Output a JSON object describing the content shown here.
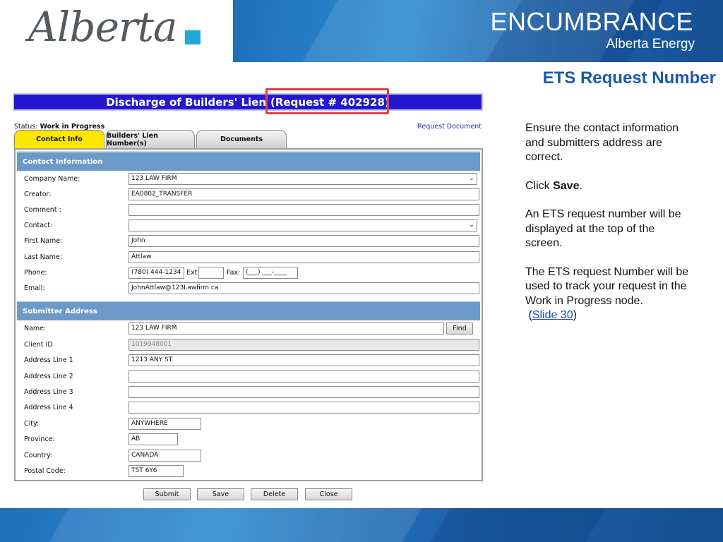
{
  "header": {
    "logo_text": "Alberta",
    "title": "ENCUMBRANCE",
    "subtitle": "Alberta Energy"
  },
  "slide_heading": "ETS Request Number",
  "notes": {
    "p1": "Ensure the contact information and submitters address are correct.",
    "p2_prefix": "Click ",
    "p2_bold": "Save",
    "p2_suffix": ".",
    "p3": "An ETS request number will be displayed at the top of the screen.",
    "p4": "The ETS request Number will be used to track your request in the Work in Progress node.",
    "link_open": "(",
    "link_text": "Slide 30",
    "link_close": ")"
  },
  "app": {
    "title_main": "Discharge of Builders' Lien",
    "title_request": "(Request # 402928)",
    "status_label": "Status:",
    "status_value": "Work in Progress",
    "request_document": "Request Document",
    "tabs": [
      "Contact Info",
      "Builders' Lien Number(s)",
      "Documents"
    ],
    "contact_section": "Contact Information",
    "contact": {
      "company_label": "Company Name:",
      "company_value": "123 LAW FIRM",
      "creator_label": "Creator:",
      "creator_value": "EA0802_TRANSFER",
      "comment_label": "Comment :",
      "comment_value": "",
      "contact_label": "Contact:",
      "contact_value": "",
      "first_label": "First Name:",
      "first_value": "John",
      "last_label": "Last Name:",
      "last_value": "Attlaw",
      "phone_label": "Phone:",
      "phone_value": "(780) 444-1234",
      "ext_label": "Ext",
      "ext_value": "",
      "fax_label": "Fax:",
      "fax_value": "(___) ___-____",
      "email_label": "Email:",
      "email_value": "JohnAttlaw@123Lawfirm.ca"
    },
    "submitter_section": "Submitter Address",
    "submitter": {
      "name_label": "Name:",
      "name_value": "123 LAW FIRM",
      "find_button": "Find",
      "client_label": "Client ID",
      "client_value": "1019948001",
      "addr1_label": "Address Line 1",
      "addr1_value": "1213 ANY ST",
      "addr2_label": "Address Line 2",
      "addr2_value": "",
      "addr3_label": "Address Line 3",
      "addr3_value": "",
      "addr4_label": "Address Line 4",
      "addr4_value": "",
      "city_label": "City:",
      "city_value": "ANYWHERE",
      "province_label": "Province:",
      "province_value": "AB",
      "country_label": "Country:",
      "country_value": "CANADA",
      "postal_label": "Postal Code:",
      "postal_value": "T5T 6Y6"
    },
    "buttons": {
      "submit": "Submit",
      "save": "Save",
      "delete": "Delete",
      "close": "Close"
    }
  },
  "colors": {
    "brand_blue": "#1f6fba",
    "title_bar": "#2516cf",
    "section_header": "#6b9ac9",
    "active_tab": "#fde600",
    "highlight": "#e0424a",
    "heading": "#1a5aa8"
  }
}
